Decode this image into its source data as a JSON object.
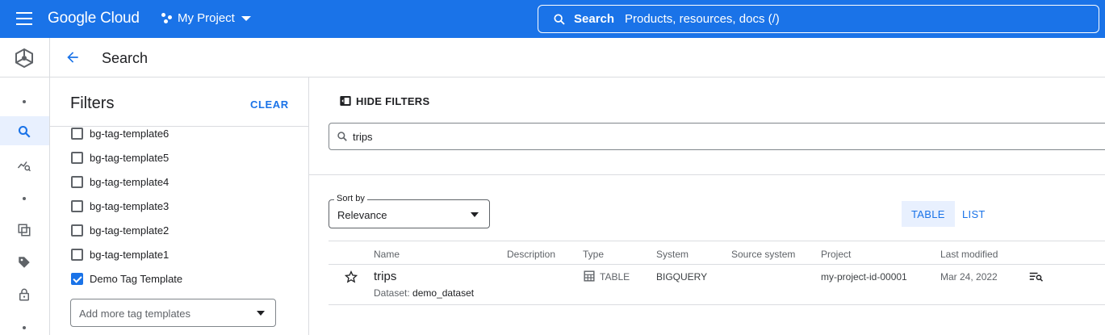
{
  "topbar": {
    "brand": "Google Cloud",
    "project": "My Project",
    "search_label": "Search",
    "search_placeholder": "Products, resources, docs (/)"
  },
  "header": {
    "title": "Search"
  },
  "filters": {
    "title": "Filters",
    "clear_label": "CLEAR",
    "items": [
      {
        "label": "bg-tag-template6",
        "checked": false
      },
      {
        "label": "bg-tag-template5",
        "checked": false
      },
      {
        "label": "bg-tag-template4",
        "checked": false
      },
      {
        "label": "bg-tag-template3",
        "checked": false
      },
      {
        "label": "bg-tag-template2",
        "checked": false
      },
      {
        "label": "bg-tag-template1",
        "checked": false
      },
      {
        "label": "Demo Tag Template",
        "checked": true
      }
    ],
    "add_more_placeholder": "Add more tag templates"
  },
  "main": {
    "hide_filters_label": "HIDE FILTERS",
    "query": "trips",
    "sort": {
      "label": "Sort by",
      "value": "Relevance"
    },
    "views": {
      "table": "TABLE",
      "list": "LIST"
    },
    "columns": {
      "name": "Name",
      "description": "Description",
      "type": "Type",
      "system": "System",
      "source_system": "Source system",
      "project": "Project",
      "last_modified": "Last modified"
    },
    "rows": [
      {
        "name": "trips",
        "dataset_label": "Dataset:",
        "dataset": "demo_dataset",
        "description": "",
        "type": "TABLE",
        "system": "BIGQUERY",
        "source_system": "",
        "project": "my-project-id-00001",
        "last_modified": "Mar 24, 2022"
      }
    ]
  },
  "colors": {
    "brand_blue": "#1a73e8",
    "active_bg": "#e8f0fe"
  }
}
